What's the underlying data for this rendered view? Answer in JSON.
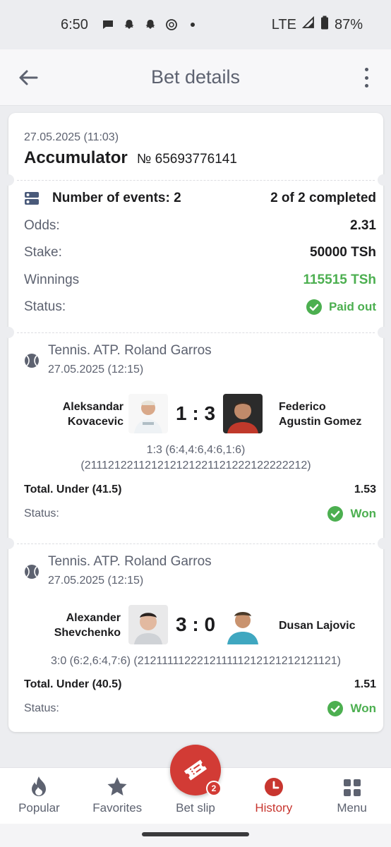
{
  "status_bar": {
    "time": "6:50",
    "network": "LTE",
    "battery": "87%"
  },
  "app_bar": {
    "title": "Bet details"
  },
  "bet": {
    "date": "27.05.2025 (11:03)",
    "type": "Accumulator",
    "number": "№ 65693776141",
    "events_label": "Number of events: 2",
    "completed": "2 of 2 completed",
    "odds_label": "Odds:",
    "odds_value": "2.31",
    "stake_label": "Stake:",
    "stake_value": "50000 TSh",
    "winnings_label": "Winnings",
    "winnings_value": "115515 TSh",
    "status_label": "Status:",
    "status_value": "Paid out"
  },
  "events": [
    {
      "league": "Tennis. ATP. Roland Garros",
      "date": "27.05.2025 (12:15)",
      "home_line1": "Aleksandar",
      "home_line2": "Kovacevic",
      "away_line1": "Federico",
      "away_line2": "Agustin Gomez",
      "score": "1 : 3",
      "detail_line1": "1:3 (6:4,4:6,4:6,1:6)",
      "detail_line2": "(211121221121212121221121222122222212)",
      "bet_name": "Total. Under (41.5)",
      "bet_odds": "1.53",
      "status_label": "Status:",
      "status_value": "Won"
    },
    {
      "league": "Tennis. ATP. Roland Garros",
      "date": "27.05.2025 (12:15)",
      "home_line1": "Alexander",
      "home_line2": "Shevchenko",
      "away_line1": "Dusan Lajovic",
      "score": "3 : 0",
      "detail_line1": "3:0 (6:2,6:4,7:6) (212111112221211111212121212121121)",
      "bet_name": "Total. Under (40.5)",
      "bet_odds": "1.51",
      "status_label": "Status:",
      "status_value": "Won"
    }
  ],
  "bottom_nav": {
    "popular": "Popular",
    "favorites": "Favorites",
    "bet_slip": "Bet slip",
    "bet_slip_badge": "2",
    "history": "History",
    "menu": "Menu"
  },
  "colors": {
    "accent": "#d23b35",
    "success": "#4caf50",
    "muted": "#5d6270"
  }
}
